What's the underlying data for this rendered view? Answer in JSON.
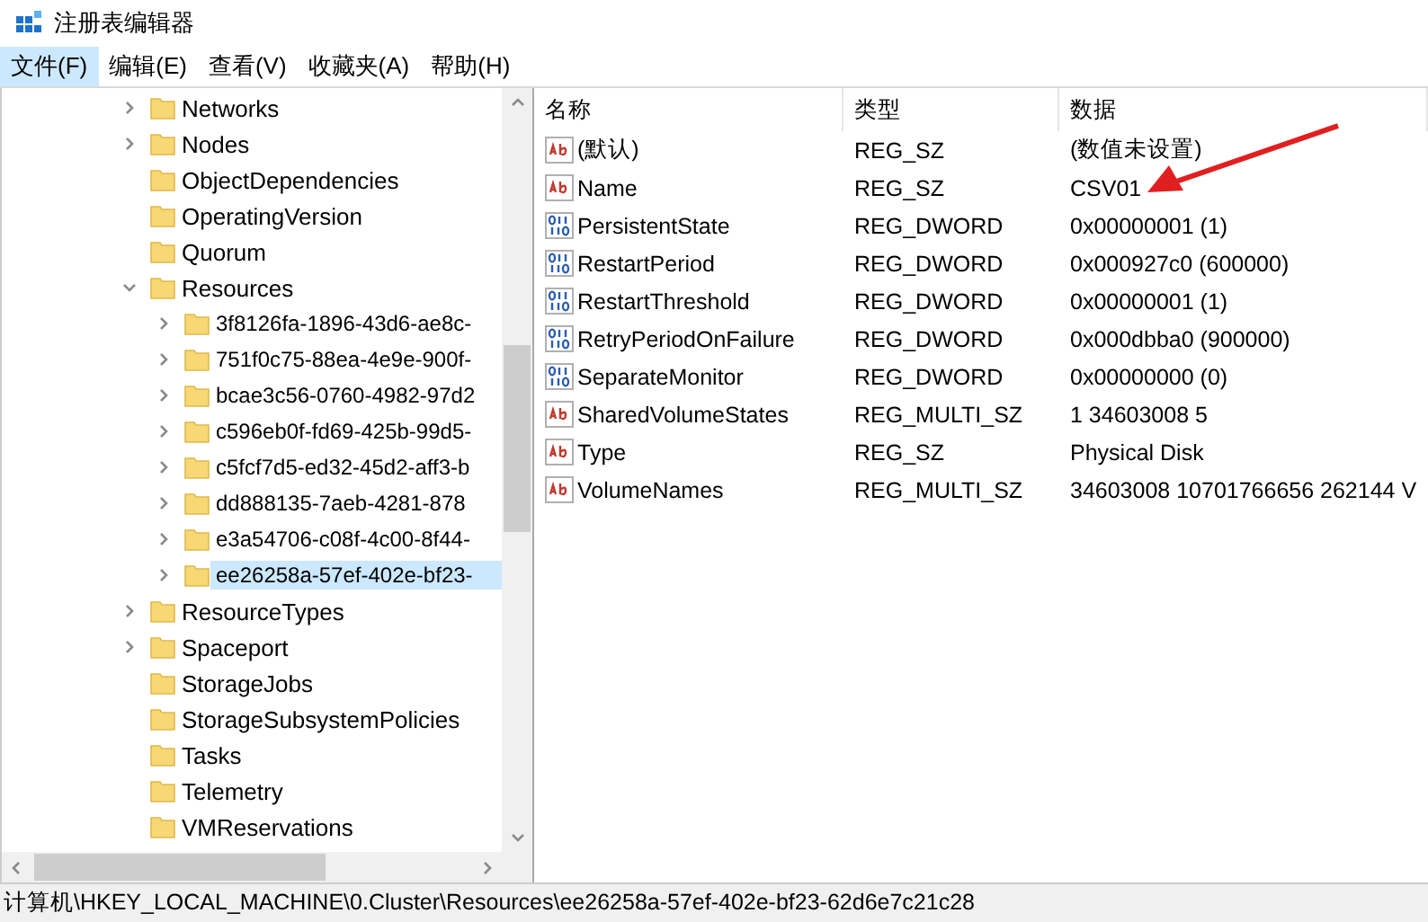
{
  "window": {
    "title": "注册表编辑器"
  },
  "menu": [
    {
      "label": "文件(F)",
      "selected": true
    },
    {
      "label": "编辑(E)",
      "selected": false
    },
    {
      "label": "查看(V)",
      "selected": false
    },
    {
      "label": "收藏夹(A)",
      "selected": false
    },
    {
      "label": "帮助(H)",
      "selected": false
    }
  ],
  "tree": {
    "items": [
      {
        "label": "Networks",
        "kind": "collapsed",
        "selected": false
      },
      {
        "label": "Nodes",
        "kind": "collapsed",
        "selected": false
      },
      {
        "label": "ObjectDependencies",
        "kind": "leaf",
        "selected": false
      },
      {
        "label": "OperatingVersion",
        "kind": "leaf",
        "selected": false
      },
      {
        "label": "Quorum",
        "kind": "leaf",
        "selected": false
      },
      {
        "label": "Resources",
        "kind": "expanded",
        "selected": false,
        "children": [
          {
            "label": "3f8126fa-1896-43d6-ae8c-",
            "kind": "collapsed",
            "selected": false
          },
          {
            "label": "751f0c75-88ea-4e9e-900f-",
            "kind": "collapsed",
            "selected": false
          },
          {
            "label": "bcae3c56-0760-4982-97d2",
            "kind": "collapsed",
            "selected": false
          },
          {
            "label": "c596eb0f-fd69-425b-99d5-",
            "kind": "collapsed",
            "selected": false
          },
          {
            "label": "c5fcf7d5-ed32-45d2-aff3-b",
            "kind": "collapsed",
            "selected": false
          },
          {
            "label": "dd888135-7aeb-4281-878",
            "kind": "collapsed",
            "selected": false
          },
          {
            "label": "e3a54706-c08f-4c00-8f44-",
            "kind": "collapsed",
            "selected": false
          },
          {
            "label": "ee26258a-57ef-402e-bf23-",
            "kind": "collapsed",
            "selected": true
          }
        ]
      },
      {
        "label": "ResourceTypes",
        "kind": "collapsed",
        "selected": false
      },
      {
        "label": "Spaceport",
        "kind": "collapsed",
        "selected": false
      },
      {
        "label": "StorageJobs",
        "kind": "leaf",
        "selected": false
      },
      {
        "label": "StorageSubsystemPolicies",
        "kind": "leaf",
        "selected": false
      },
      {
        "label": "Tasks",
        "kind": "leaf",
        "selected": false
      },
      {
        "label": "Telemetry",
        "kind": "leaf",
        "selected": false
      },
      {
        "label": "VMReservations",
        "kind": "leaf",
        "selected": false
      }
    ]
  },
  "table": {
    "columns": [
      "名称",
      "类型",
      "数据"
    ],
    "rows": [
      {
        "kind": "string",
        "name": "(默认)",
        "type": "REG_SZ",
        "data": "(数值未设置)"
      },
      {
        "kind": "string",
        "name": "Name",
        "type": "REG_SZ",
        "data": "CSV01"
      },
      {
        "kind": "binary",
        "name": "PersistentState",
        "type": "REG_DWORD",
        "data": "0x00000001 (1)"
      },
      {
        "kind": "binary",
        "name": "RestartPeriod",
        "type": "REG_DWORD",
        "data": "0x000927c0 (600000)"
      },
      {
        "kind": "binary",
        "name": "RestartThreshold",
        "type": "REG_DWORD",
        "data": "0x00000001 (1)"
      },
      {
        "kind": "binary",
        "name": "RetryPeriodOnFailure",
        "type": "REG_DWORD",
        "data": "0x000dbba0 (900000)"
      },
      {
        "kind": "binary",
        "name": "SeparateMonitor",
        "type": "REG_DWORD",
        "data": "0x00000000 (0)"
      },
      {
        "kind": "string",
        "name": "SharedVolumeStates",
        "type": "REG_MULTI_SZ",
        "data": "1 34603008 5"
      },
      {
        "kind": "string",
        "name": "Type",
        "type": "REG_SZ",
        "data": "Physical Disk"
      },
      {
        "kind": "string",
        "name": "VolumeNames",
        "type": "REG_MULTI_SZ",
        "data": "34603008 10701766656 262144 V"
      }
    ]
  },
  "status_bar": "计算机\\HKEY_LOCAL_MACHINE\\0.Cluster\\Resources\\ee26258a-57ef-402e-bf23-62d6e7c21c28"
}
